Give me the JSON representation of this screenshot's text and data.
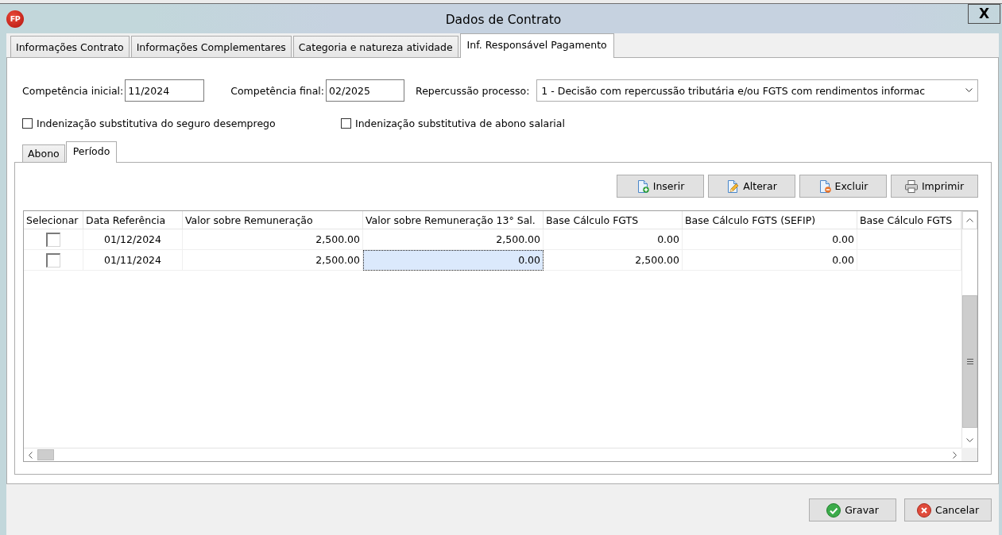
{
  "window": {
    "app_icon": "FP",
    "title": "Dados de Contrato",
    "close_label": "X"
  },
  "tabs": [
    {
      "label": "Informações Contrato",
      "selected": false
    },
    {
      "label": "Informações Complementares",
      "selected": false
    },
    {
      "label": "Categoria e natureza atividade",
      "selected": false
    },
    {
      "label": "Inf. Responsável Pagamento",
      "selected": true
    }
  ],
  "form": {
    "competencia_inicial": {
      "label": "Competência inicial:",
      "value": "11/2024"
    },
    "competencia_final": {
      "label": "Competência final:",
      "value": "02/2025"
    },
    "repercussao_processo": {
      "label": "Repercussão processo:",
      "value": "1 - Decisão com repercussão tributária e/ou FGTS com rendimentos informac"
    },
    "checkboxes": [
      {
        "label": "Indenização substitutiva do seguro desemprego",
        "checked": false
      },
      {
        "label": "Indenização substitutiva de abono salarial",
        "checked": false
      }
    ]
  },
  "subtabs": [
    {
      "label": "Abono",
      "selected": false
    },
    {
      "label": "Período",
      "selected": true
    }
  ],
  "toolbar": [
    {
      "label": "Inserir",
      "kind": "insert"
    },
    {
      "label": "Alterar",
      "kind": "edit"
    },
    {
      "label": "Excluir",
      "kind": "delete"
    },
    {
      "label": "Imprimir",
      "kind": "print"
    }
  ],
  "table": {
    "columns": [
      "Selecionar",
      "Data Referência",
      "Valor sobre Remuneração",
      "Valor sobre Remuneração 13° Sal.",
      "Base Cálculo FGTS",
      "Base Cálculo FGTS (SEFIP)",
      "Base Cálculo FGTS"
    ],
    "rows": [
      {
        "cells": [
          {
            "kind": "checkbox",
            "checked": false,
            "selected": false
          },
          {
            "kind": "text",
            "text": "01/12/2024",
            "selected": false
          },
          {
            "kind": "text",
            "text": "2,500.00",
            "selected": false
          },
          {
            "kind": "text",
            "text": "2,500.00",
            "selected": false
          },
          {
            "kind": "text",
            "text": "0.00",
            "selected": false
          },
          {
            "kind": "text",
            "text": "0.00",
            "selected": false
          }
        ]
      },
      {
        "cells": [
          {
            "kind": "checkbox",
            "checked": false,
            "selected": false
          },
          {
            "kind": "text",
            "text": "01/11/2024",
            "selected": false
          },
          {
            "kind": "text",
            "text": "2,500.00",
            "selected": false
          },
          {
            "kind": "text",
            "text": "0.00",
            "selected": true
          },
          {
            "kind": "text",
            "text": "2,500.00",
            "selected": false
          },
          {
            "kind": "text",
            "text": "0.00",
            "selected": false
          }
        ]
      }
    ]
  },
  "buttons": [
    {
      "label": "Gravar",
      "kind": "save"
    },
    {
      "label": "Cancelar",
      "kind": "cancel"
    }
  ]
}
